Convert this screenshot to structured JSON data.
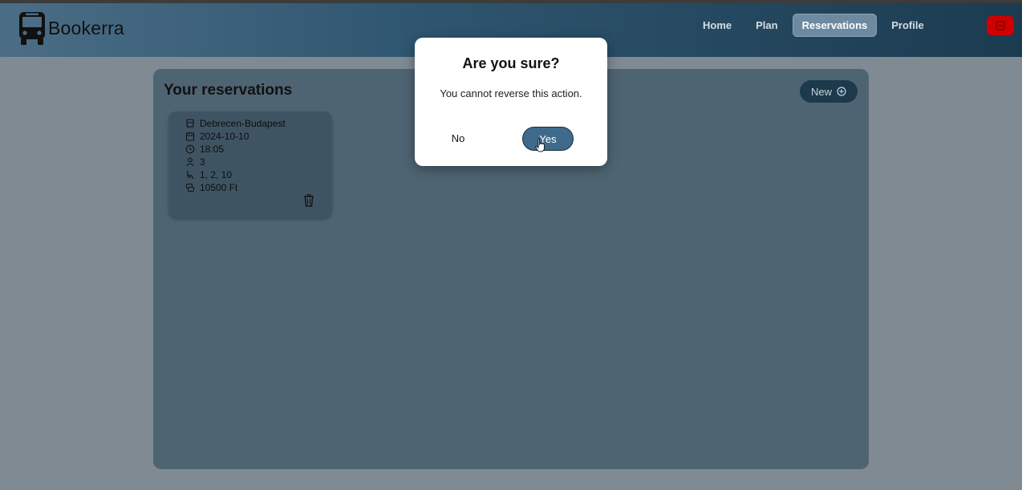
{
  "brand": {
    "name": "Bookerra",
    "icon": "bus-icon"
  },
  "nav": {
    "items": [
      {
        "label": "Home",
        "active": false
      },
      {
        "label": "Plan",
        "active": false
      },
      {
        "label": "Reservations",
        "active": true
      },
      {
        "label": "Profile",
        "active": false
      }
    ],
    "logout_icon": "logout-icon",
    "logout_color": "#d10000"
  },
  "panel": {
    "title": "Your reservations",
    "new_button": {
      "label": "New",
      "icon": "plus-circle-icon"
    }
  },
  "reservation": {
    "route": "Debrecen-Budapest",
    "date": "2024-10-10",
    "time": "18:05",
    "passengers": "3",
    "seats": "1, 2, 10",
    "price": "10500 Ft",
    "icons": [
      "bus-icon",
      "calendar-icon",
      "clock-icon",
      "person-icon",
      "seat-icon",
      "money-icon",
      "trash-icon"
    ]
  },
  "dialog": {
    "title": "Are you sure?",
    "message": "You cannot reverse this action.",
    "no_label": "No",
    "yes_label": "Yes"
  },
  "colors": {
    "accent": "#3e6b8b",
    "panel": "#4f6473",
    "nav_dark": "#1b3b50"
  }
}
